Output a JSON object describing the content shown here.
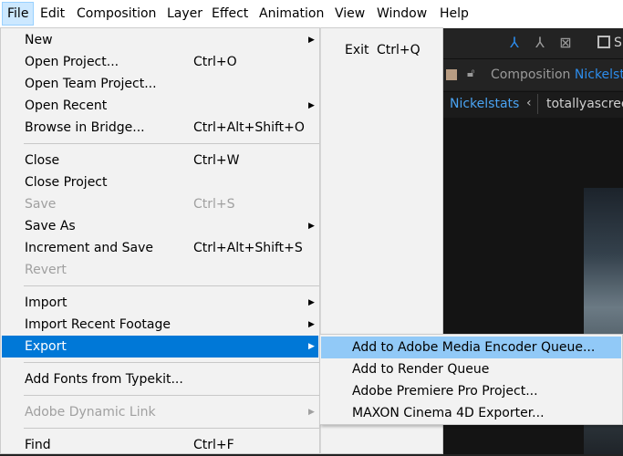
{
  "menubar": {
    "items": [
      "File",
      "Edit",
      "Composition",
      "Layer",
      "Effect",
      "Animation",
      "View",
      "Window",
      "Help"
    ]
  },
  "file_menu": {
    "new": {
      "label": "New"
    },
    "open_project": {
      "label": "Open Project...",
      "shortcut": "Ctrl+O"
    },
    "open_team_project": {
      "label": "Open Team Project..."
    },
    "open_recent": {
      "label": "Open Recent"
    },
    "browse_in_bridge": {
      "label": "Browse in Bridge...",
      "shortcut": "Ctrl+Alt+Shift+O"
    },
    "close": {
      "label": "Close",
      "shortcut": "Ctrl+W"
    },
    "close_project": {
      "label": "Close Project"
    },
    "save": {
      "label": "Save",
      "shortcut": "Ctrl+S"
    },
    "save_as": {
      "label": "Save As"
    },
    "increment_and_save": {
      "label": "Increment and Save",
      "shortcut": "Ctrl+Alt+Shift+S"
    },
    "revert": {
      "label": "Revert"
    },
    "import": {
      "label": "Import"
    },
    "import_recent_footage": {
      "label": "Import Recent Footage"
    },
    "export": {
      "label": "Export"
    },
    "add_fonts_from_typekit": {
      "label": "Add Fonts from Typekit..."
    },
    "adobe_dynamic_link": {
      "label": "Adobe Dynamic Link"
    },
    "find": {
      "label": "Find",
      "shortcut": "Ctrl+F"
    }
  },
  "exit_menu": {
    "label": "Exit",
    "shortcut": "Ctrl+Q"
  },
  "export_menu": {
    "items": [
      "Add to Adobe Media Encoder Queue...",
      "Add to Render Queue",
      "Adobe Premiere Pro Project...",
      "MAXON Cinema 4D Exporter..."
    ]
  },
  "background_app": {
    "composition_label": "Composition",
    "composition_name": "Nickelstats",
    "tabs": [
      "Nickelstats",
      "totallyascreen"
    ],
    "snap_label": "S"
  },
  "colors": {
    "highlight": "#0078d7",
    "submenu_hover": "#91c9f7",
    "accent_blue": "#2d8ceb"
  }
}
